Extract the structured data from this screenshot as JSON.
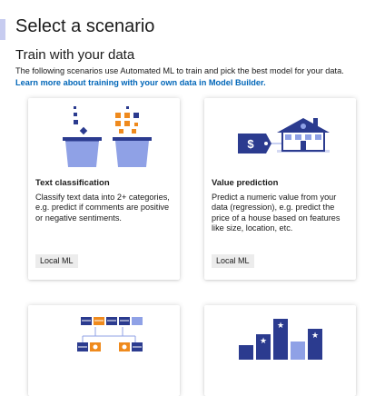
{
  "header": {
    "title": "Select a scenario",
    "section_title": "Train with your data",
    "description": "The following scenarios use Automated ML to train and pick the best model for your data.",
    "learn_more_link": "Learn more about training with your own data in Model Builder."
  },
  "cards": [
    {
      "title": "Text classification",
      "description": "Classify text data into 2+ categories, e.g. predict if comments are positive or negative sentiments.",
      "tag": "Local ML",
      "icon": "text-classification-icon"
    },
    {
      "title": "Value prediction",
      "description": "Predict a numeric value from your data (regression), e.g. predict the price of a house based on features like size, location, etc.",
      "tag": "Local ML",
      "icon": "value-prediction-icon",
      "icon_text": "$"
    },
    {
      "icon": "recommendation-icon"
    },
    {
      "icon": "ranking-chart-icon"
    }
  ],
  "colors": {
    "accent_bar": "#c7ccf0",
    "link": "#0066b8",
    "icon_blue_light": "#8fa1e6",
    "icon_blue_dark": "#2b3b8f",
    "icon_orange": "#ef8a1d"
  }
}
